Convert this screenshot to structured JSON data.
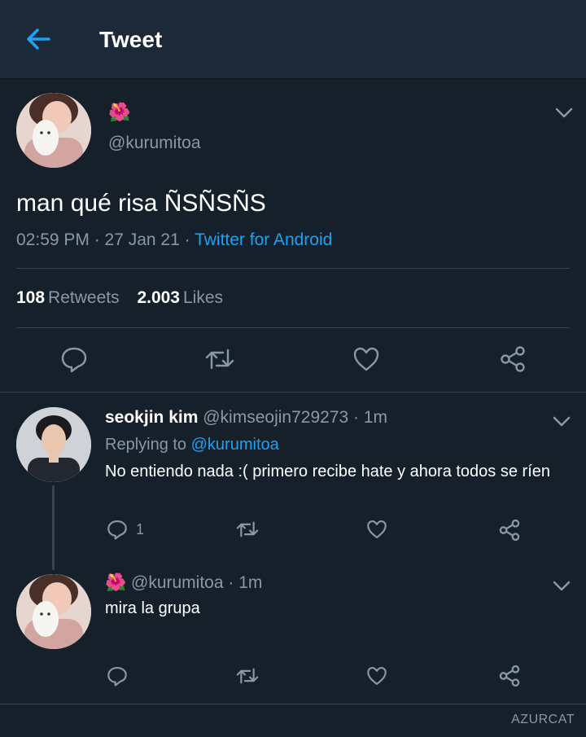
{
  "header": {
    "title": "Tweet",
    "back_icon": "arrow-left-icon"
  },
  "tweet": {
    "emoji": "🌺",
    "handle": "@kurumitoa",
    "text": "man qué risa ÑSÑSÑS",
    "time_date": "02:59 PM · 27 Jan 21 · ",
    "source": "Twitter for Android",
    "retweets_count": "108",
    "retweets_label": "Retweets",
    "likes_count": "2.003",
    "likes_label": "Likes"
  },
  "replies": [
    {
      "name": "seokjin kim",
      "handle": "@kimseojin729273",
      "time": " · 1m",
      "replying_label": "Replying to ",
      "replying_to": "@kurumitoa",
      "text": "No entiendo nada :( primero recibe hate y ahora todos se ríen",
      "reply_count": "1"
    },
    {
      "emoji": "🌺",
      "handle": "@kurumitoa",
      "time": " · 1m",
      "text": "mira la grupa"
    }
  ],
  "watermark": "AZURCAT",
  "colors": {
    "background": "#15202b",
    "header": "#1c2938",
    "muted": "#8899a6",
    "accent": "#1da1f2",
    "divider": "#38444d"
  }
}
